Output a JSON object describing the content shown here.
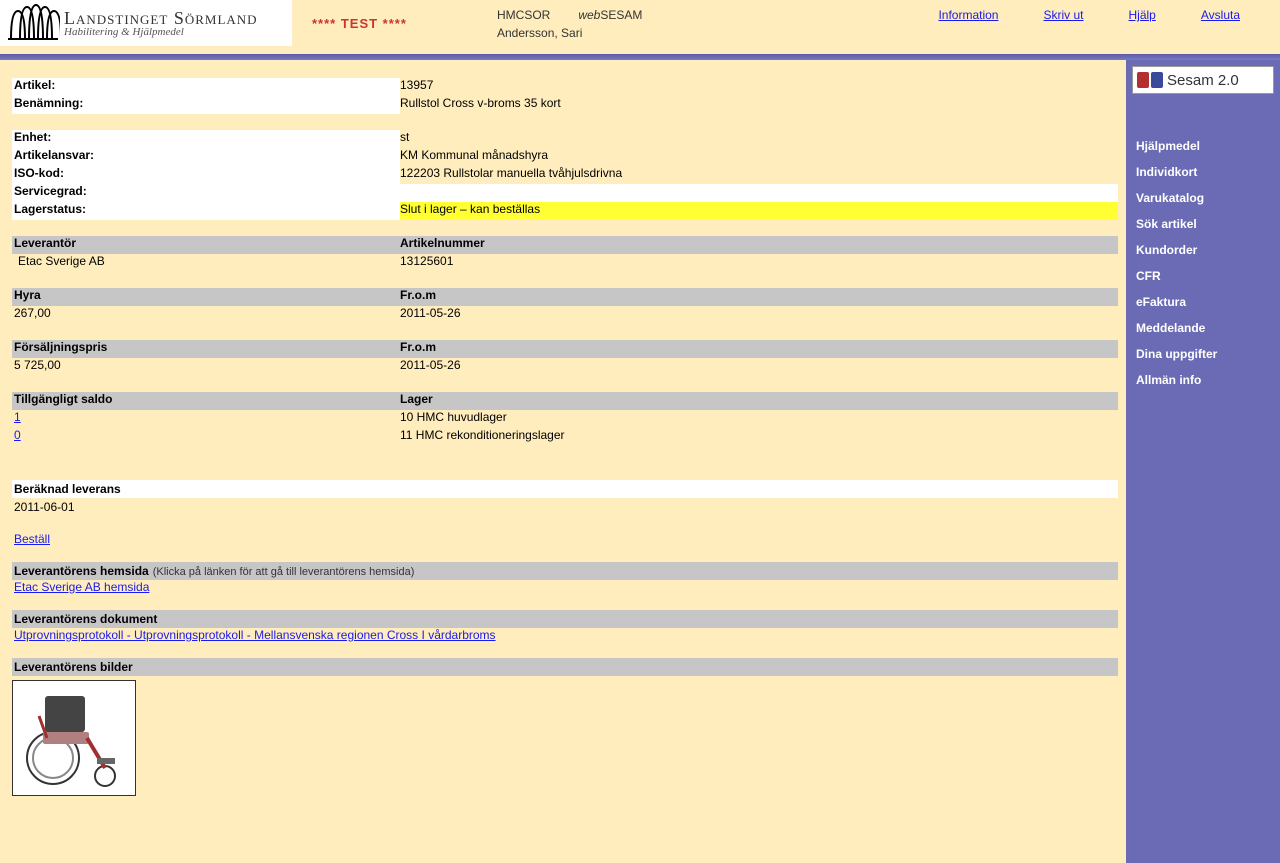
{
  "header": {
    "org_line1": "Landstinget Sörmland",
    "org_line2": "Habilitering & Hjälpmedel",
    "test_label": "**** TEST ****",
    "code": "HMCSOR",
    "app_prefix": "web",
    "app_name": "SESAM",
    "user": "Andersson, Sari",
    "links": {
      "information": "Information",
      "print": "Skriv ut",
      "help": "Hjälp",
      "logout": "Avsluta"
    }
  },
  "sidebar": {
    "badge": "Sesam 2.0",
    "items": [
      "Hjälpmedel",
      "Individkort",
      "Varukatalog",
      "Sök artikel",
      "Kundorder",
      "CFR",
      "eFaktura",
      "Meddelande",
      "Dina uppgifter",
      "Allmän info"
    ]
  },
  "article": {
    "labels": {
      "artikel": "Artikel:",
      "benamning": "Benämning:",
      "enhet": "Enhet:",
      "artikelansvar": "Artikelansvar:",
      "isokod": "ISO-kod:",
      "servicegrad": "Servicegrad:",
      "lagerstatus": "Lagerstatus:"
    },
    "values": {
      "artikel": "13957",
      "benamning": "Rullstol Cross v-broms 35 kort",
      "enhet": "st",
      "artikelansvar": "KM  Kommunal månadshyra",
      "isokod": "122203  Rullstolar manuella tvåhjulsdrivna",
      "servicegrad": "",
      "lagerstatus": "Slut i lager – kan beställas"
    }
  },
  "supplier_table": {
    "head1": "Leverantör",
    "head2": "Artikelnummer",
    "name": "Etac Sverige AB",
    "artno": "13125601"
  },
  "rent_table": {
    "head1": "Hyra",
    "head2": "Fr.o.m",
    "val1": "267,00",
    "val2": "2011-05-26"
  },
  "price_table": {
    "head1": "Försäljningspris",
    "head2": "Fr.o.m",
    "val1": "5 725,00",
    "val2": "2011-05-26"
  },
  "stock_table": {
    "head1": "Tillgängligt saldo",
    "head2": "Lager",
    "rows": [
      {
        "qty": "1",
        "store": "10 HMC huvudlager"
      },
      {
        "qty": "0",
        "store": "11 HMC rekonditioneringslager"
      }
    ]
  },
  "delivery": {
    "head": "Beräknad leverans",
    "date": "2011-06-01"
  },
  "order_link": "Beställ",
  "vendor_site": {
    "head": "Leverantörens hemsida",
    "hint": "(Klicka på länken för att gå till leverantörens hemsida)",
    "link": "Etac Sverige AB hemsida"
  },
  "vendor_docs": {
    "head": "Leverantörens dokument",
    "link": "Utprovningsprotokoll - Utprovningsprotokoll - Mellansvenska regionen Cross I vårdarbroms"
  },
  "vendor_images": {
    "head": "Leverantörens bilder"
  }
}
